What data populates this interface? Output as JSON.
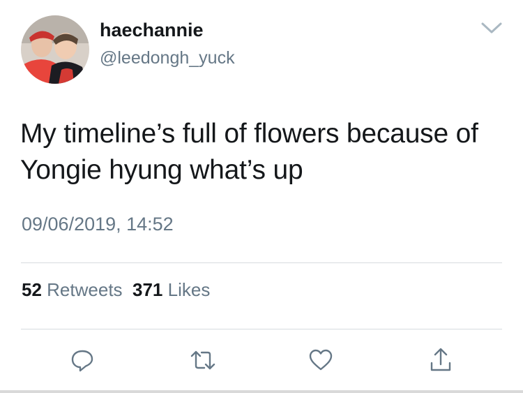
{
  "tweet": {
    "display_name": "haechannie",
    "handle": "@leedongh_yuck",
    "text": "My timeline’s full of flowers because of Yongie hyung what’s up",
    "timestamp": "09/06/2019, 14:52"
  },
  "stats": {
    "retweets_count": "52",
    "retweets_label": "Retweets",
    "likes_count": "371",
    "likes_label": "Likes"
  },
  "icons": {
    "more": "chevron-down-icon",
    "reply": "reply-icon",
    "retweet": "retweet-icon",
    "like": "heart-icon",
    "share": "share-icon"
  },
  "colors": {
    "text_primary": "#14171a",
    "text_secondary": "#657786",
    "icon": "#657786",
    "divider": "#d7dbdf"
  }
}
